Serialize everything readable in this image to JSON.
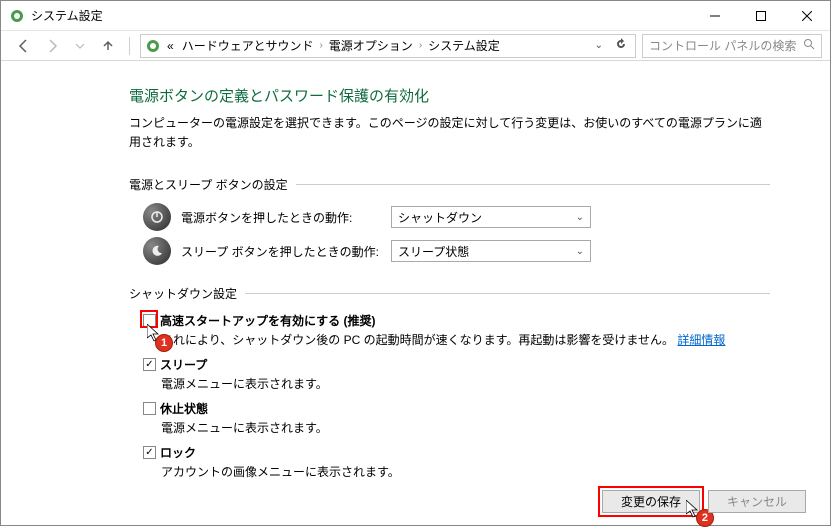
{
  "window": {
    "title": "システム設定"
  },
  "breadcrumb": {
    "prefix": "«",
    "parts": [
      "ハードウェアとサウンド",
      "電源オプション",
      "システム設定"
    ]
  },
  "search": {
    "placeholder": "コントロール パネルの検索"
  },
  "page": {
    "heading": "電源ボタンの定義とパスワード保護の有効化",
    "description": "コンピューターの電源設定を選択できます。このページの設定に対して行う変更は、お使いのすべての電源プランに適用されます。"
  },
  "section1": {
    "title": "電源とスリープ ボタンの設定",
    "rows": [
      {
        "label": "電源ボタンを押したときの動作:",
        "value": "シャットダウン"
      },
      {
        "label": "スリープ ボタンを押したときの動作:",
        "value": "スリープ状態"
      }
    ]
  },
  "section2": {
    "title": "シャットダウン設定",
    "items": [
      {
        "checked": false,
        "label": "高速スタートアップを有効にする (推奨)",
        "desc_prefix": "これにより、シャットダウン後の PC の起動時間が速くなります。再起動は影響を受けません。",
        "link": "詳細情報"
      },
      {
        "checked": true,
        "label": "スリープ",
        "desc": "電源メニューに表示されます。"
      },
      {
        "checked": false,
        "label": "休止状態",
        "desc": "電源メニューに表示されます。"
      },
      {
        "checked": true,
        "label": "ロック",
        "desc": "アカウントの画像メニューに表示されます。"
      }
    ]
  },
  "buttons": {
    "save": "変更の保存",
    "cancel": "キャンセル"
  },
  "annotations": {
    "badge1": "1",
    "badge2": "2"
  }
}
